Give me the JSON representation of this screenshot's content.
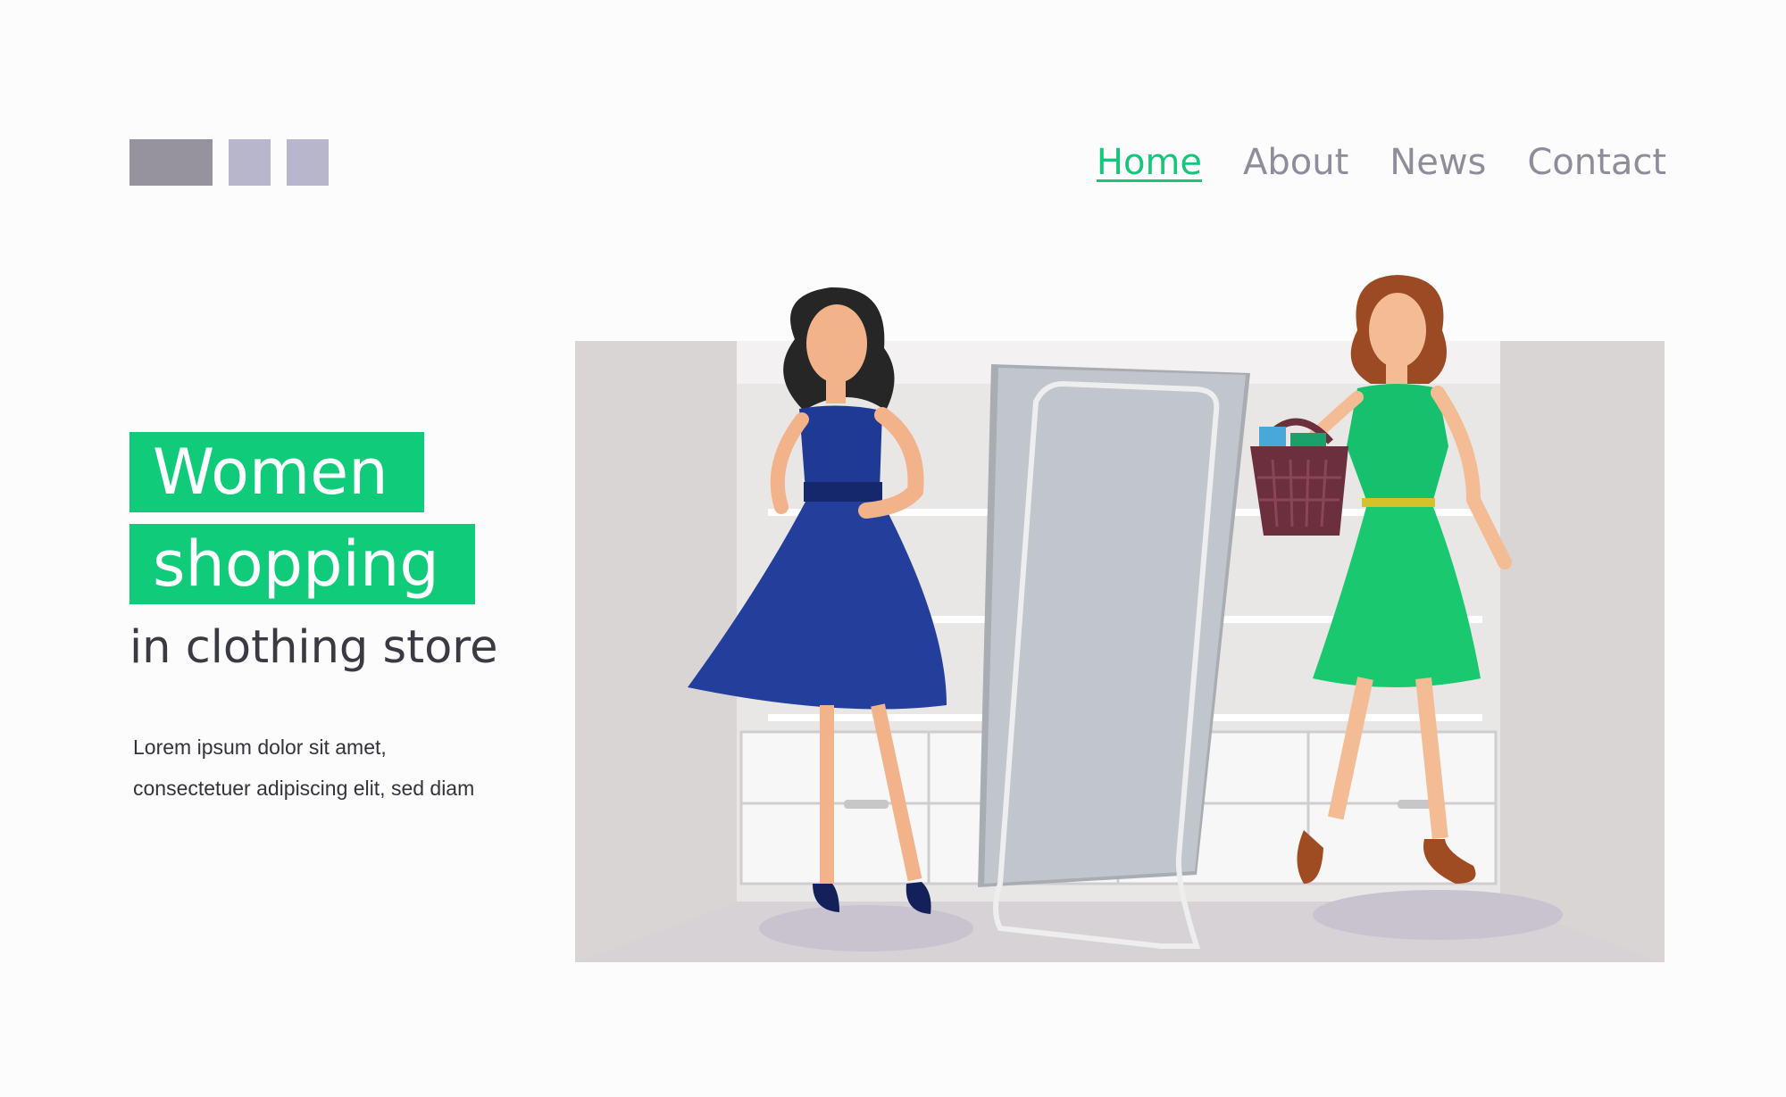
{
  "nav": {
    "items": [
      {
        "label": "Home",
        "active": true
      },
      {
        "label": "About",
        "active": false
      },
      {
        "label": "News",
        "active": false
      },
      {
        "label": "Contact",
        "active": false
      }
    ]
  },
  "hero": {
    "title_line1": "Women",
    "title_line2": "shopping",
    "subtitle": "in clothing store",
    "body_line1": "Lorem ipsum dolor sit amet,",
    "body_line2": "consectetuer adipiscing elit, sed diam"
  },
  "colors": {
    "accent": "#10cc7a",
    "nav_active": "#17c57b",
    "nav_inactive": "#8f8d99",
    "logo_dark": "#96939f",
    "logo_light": "#b8b6cc"
  },
  "illustration": {
    "subject": "two women in a fitting room with a mirror",
    "icons": [
      "mirror-icon",
      "shopping-basket-icon"
    ]
  }
}
